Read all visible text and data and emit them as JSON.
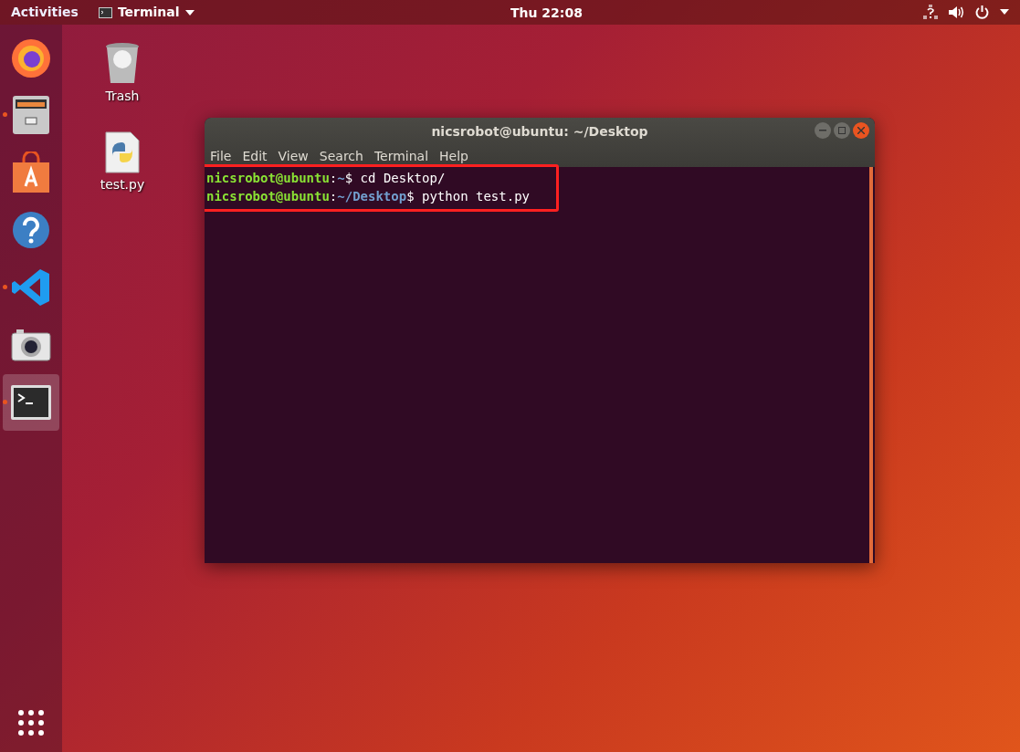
{
  "top_bar": {
    "activities": "Activities",
    "app_menu": "Terminal",
    "clock": "Thu 22:08"
  },
  "dock": {
    "items": [
      {
        "kind": "firefox",
        "running": false,
        "selected": false
      },
      {
        "kind": "files",
        "running": true,
        "selected": false
      },
      {
        "kind": "software",
        "running": false,
        "selected": false
      },
      {
        "kind": "help",
        "running": false,
        "selected": false
      },
      {
        "kind": "vscode",
        "running": true,
        "selected": false
      },
      {
        "kind": "camera",
        "running": false,
        "selected": false
      },
      {
        "kind": "terminal",
        "running": true,
        "selected": true
      }
    ]
  },
  "desktop_icons": [
    {
      "kind": "trash",
      "label": "Trash"
    },
    {
      "kind": "python",
      "label": "test.py"
    }
  ],
  "window": {
    "title": "nicsrobot@ubuntu: ~/Desktop",
    "menu": [
      "File",
      "Edit",
      "View",
      "Search",
      "Terminal",
      "Help"
    ],
    "highlighted": true,
    "lines": [
      {
        "user": "nicsrobot@ubuntu",
        "sep": ":",
        "path": "~",
        "command": "$ cd Desktop/"
      },
      {
        "user": "nicsrobot@ubuntu",
        "sep": ":",
        "path": "~/Desktop",
        "command": "$ python test.py"
      }
    ]
  }
}
